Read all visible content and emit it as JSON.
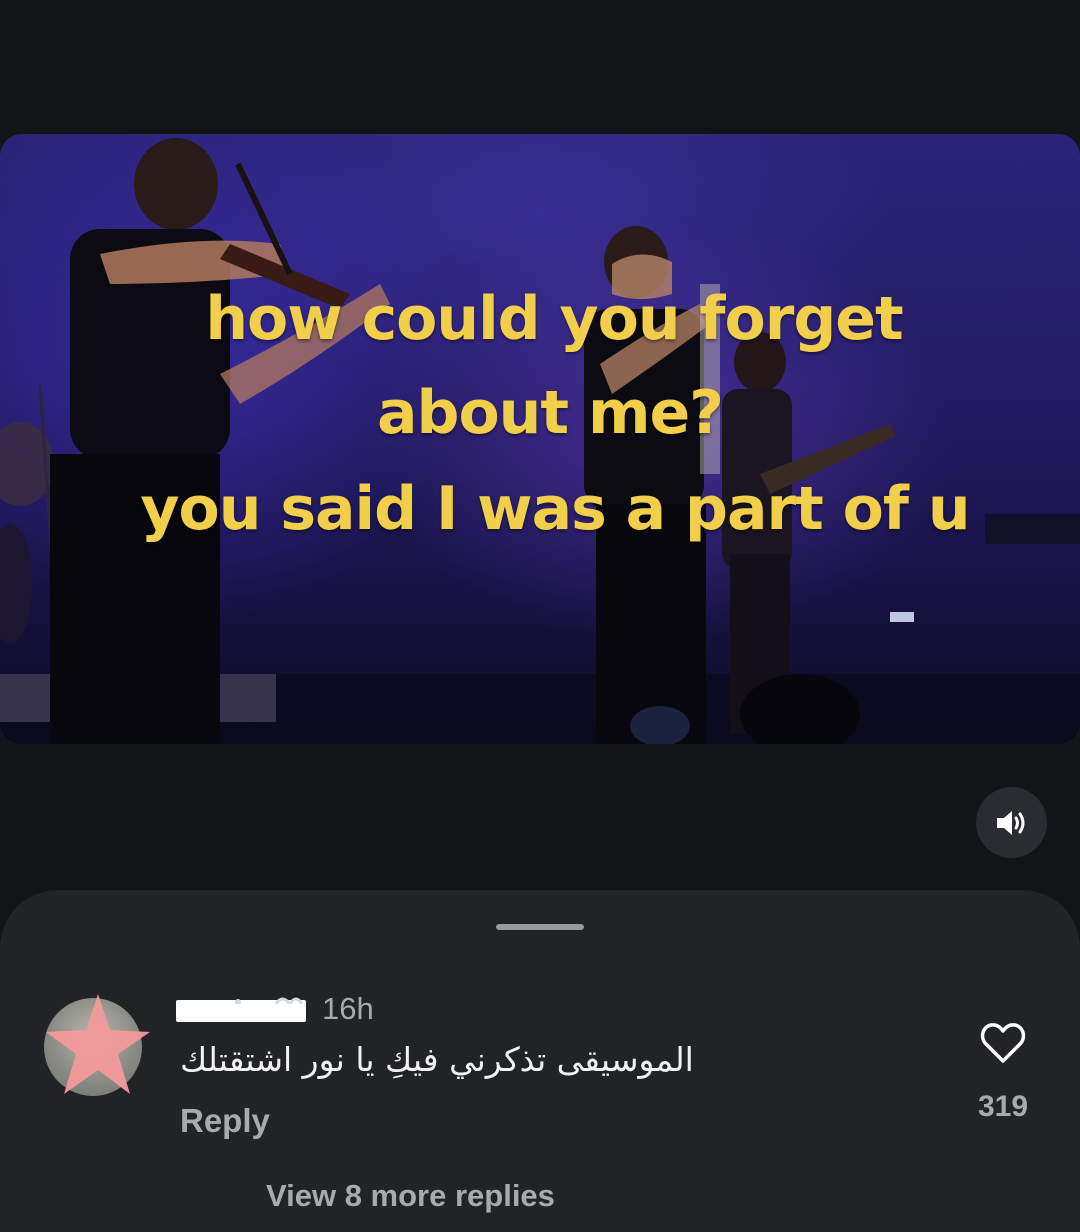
{
  "video": {
    "caption_lines": [
      "how could you forget",
      "about me?",
      "you said I was a part of u"
    ],
    "caption_color": "#f1cf4a"
  },
  "controls": {
    "mute_icon": "speaker-volume-icon"
  },
  "comments": {
    "items": [
      {
        "username_redacted": true,
        "timestamp": "16h",
        "text": "الموسيقى تذكرني فيكِ يا نور اشتقتلك",
        "reply_label": "Reply",
        "like_icon": "heart-outline-icon",
        "like_count": "319"
      }
    ],
    "view_more_label": "View 8 more replies"
  },
  "colors": {
    "background": "#121418",
    "sheet": "#222327",
    "muted_text": "#a9aaae",
    "avatar_overlay": "#f29a9a"
  }
}
